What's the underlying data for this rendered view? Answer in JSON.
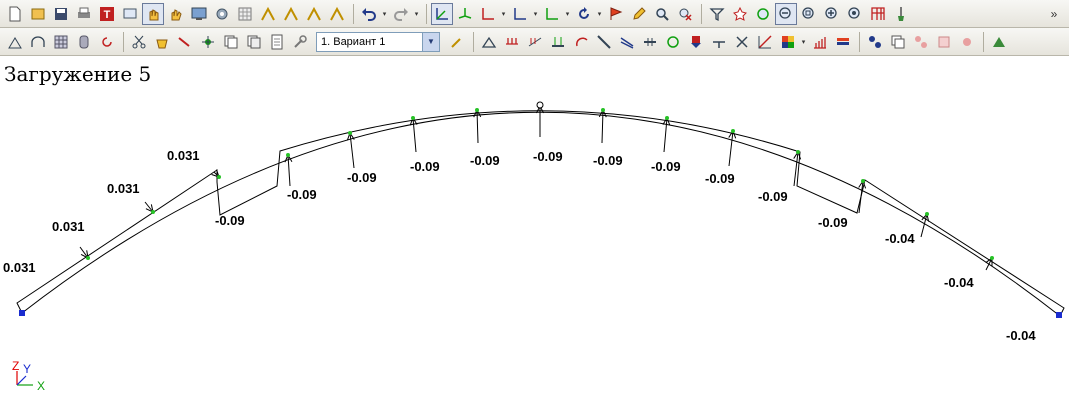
{
  "load_case": {
    "title": "Загружение 5"
  },
  "toolbar": {
    "variant_select": {
      "selected": "1. Вариант 1"
    },
    "overflow_label": "»"
  },
  "diagram": {
    "values_left": [
      "0.031",
      "0.031",
      "0.031",
      "0.031"
    ],
    "values_mid": [
      "-0.09",
      "-0.09",
      "-0.09",
      "-0.09",
      "-0.09",
      "-0.09",
      "-0.09",
      "-0.09",
      "-0.09",
      "-0.09"
    ],
    "values_right": [
      "-0.04",
      "-0.04",
      "-0.04"
    ]
  },
  "axes": {
    "z": "Z",
    "y": "Y",
    "x": "X"
  },
  "colors": {
    "node": "#1a2ccf",
    "arrow_base": "#27c227",
    "axis_z": "#e00000",
    "axis_y": "#1a2ccf",
    "axis_x": "#10a010"
  }
}
